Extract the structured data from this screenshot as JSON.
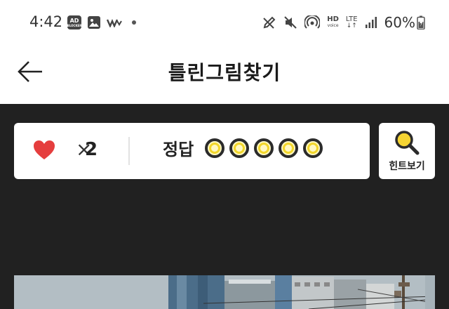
{
  "status_bar": {
    "time": "4:42",
    "icons": [
      "ad-blocker-icon",
      "gallery-icon",
      "app-notification-icon",
      "dot-icon",
      "pen-icon",
      "mute-icon",
      "hotspot-icon",
      "hd-voice-icon",
      "lte-icon",
      "signal-icon",
      "battery-icon"
    ],
    "ad_badge": "AD",
    "ad_badge_sub": "BLOCKER",
    "hd_label": "HD",
    "hd_sub": "voice",
    "lte_label": "LTE",
    "lte_arrows": "↓↑",
    "battery": "60%"
  },
  "header": {
    "back_icon": "arrow-left-icon",
    "title": "틀린그림찾기"
  },
  "score_panel": {
    "lives_icon": "heart-icon",
    "lives_symbol": "×",
    "lives_count": "2",
    "answer_label": "정답",
    "answers_found": 0,
    "answers_total": 5
  },
  "hint_button": {
    "icon": "magnifier-icon",
    "label": "힌트보기"
  },
  "colors": {
    "game_background": "#212121",
    "heart": "#e53e3e",
    "answer_circle_ring": "#f2d62a",
    "answer_circle_fill": "#fff8c2",
    "hint_icon": "#f5d432"
  }
}
